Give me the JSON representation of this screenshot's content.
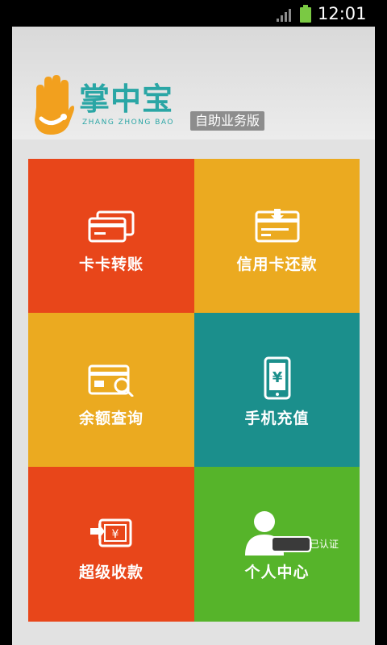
{
  "status_bar": {
    "time": "12:01",
    "icons": [
      "signal-icon",
      "battery-icon"
    ]
  },
  "brand": {
    "name": "掌中宝",
    "pinyin": "ZHANG ZHONG BAO",
    "edition_badge": "自助业务版",
    "colors": {
      "brand": "#2aa6a5",
      "hand": "#f2a01e",
      "badge": "#8d8d8d"
    }
  },
  "menu": {
    "tiles": [
      {
        "label": "卡卡转账",
        "icon": "card-transfer-icon",
        "color": "#e8461a"
      },
      {
        "label": "信用卡还款",
        "icon": "credit-card-repay-icon",
        "color": "#ebaa20"
      },
      {
        "label": "余额查询",
        "icon": "balance-search-icon",
        "color": "#ebaa20"
      },
      {
        "label": "手机充值",
        "icon": "phone-recharge-icon",
        "color": "#1b8f8c"
      },
      {
        "label": "超级收款",
        "icon": "super-receive-icon",
        "color": "#e8461a"
      },
      {
        "label": "个人中心",
        "icon": "user-verified-icon",
        "color": "#56b42a",
        "badge": "已认证"
      }
    ]
  }
}
